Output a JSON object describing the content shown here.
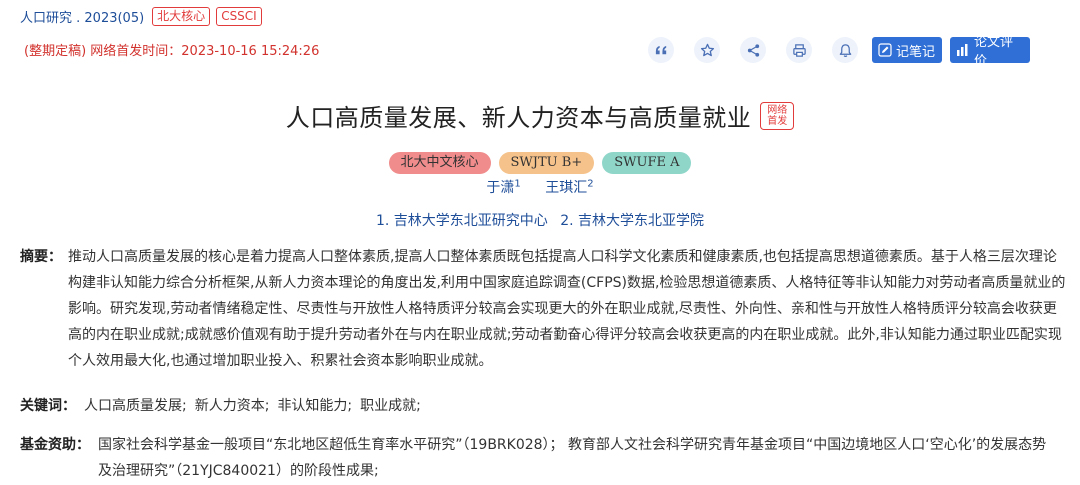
{
  "header": {
    "journal": "人口研究 . 2023(05)",
    "tags": [
      "北大核心",
      "CSSCI"
    ],
    "pub_status": "(整期定稿) 网络首发时间：2023-10-16 15:24:26"
  },
  "toolbar": {
    "icons": [
      "quote-icon",
      "star-icon",
      "share-icon",
      "print-icon",
      "bell-icon"
    ],
    "note_label": "记笔记",
    "eval_label": "论文评价",
    "accent": "#2f6fd6"
  },
  "article": {
    "title": "人口高质量发展、新人力资本与高质量就业",
    "net_badge_line1": "网络",
    "net_badge_line2": "首发",
    "rank_badges": [
      {
        "label": "北大中文核心",
        "color": "#f08c8c"
      },
      {
        "label": "SWJTU B+",
        "color": "#f6c28b"
      },
      {
        "label": "SWUFE A",
        "color": "#8fd6c9"
      }
    ],
    "authors": [
      {
        "name": "于潇",
        "sup": "1"
      },
      {
        "name": "王琪汇",
        "sup": "2"
      }
    ],
    "affiliations": [
      "1. 吉林大学东北亚研究中心",
      "2. 吉林大学东北亚学院"
    ],
    "abstract_label": "摘要：",
    "abstract": "推动人口高质量发展的核心是着力提高人口整体素质,提高人口整体素质既包括提高人口科学文化素质和健康素质,也包括提高思想道德素质。基于人格三层次理论构建非认知能力综合分析框架,从新人力资本理论的角度出发,利用中国家庭追踪调查(CFPS)数据,检验思想道德素质、人格特征等非认知能力对劳动者高质量就业的影响。研究发现,劳动者情绪稳定性、尽责性与开放性人格特质评分较高会实现更大的外在职业成就,尽责性、外向性、亲和性与开放性人格特质评分较高会收获更高的内在职业成就;成就感价值观有助于提升劳动者外在与内在职业成就;劳动者勤奋心得评分较高会收获更高的内在职业成就。此外,非认知能力通过职业匹配实现个人效用最大化,也通过增加职业投入、积累社会资本影响职业成就。",
    "keywords_label": "关键词：",
    "keywords": [
      "人口高质量发展;",
      "新人力资本;",
      "非认知能力;",
      "职业成就;"
    ],
    "fund_label": "基金资助：",
    "fund": "国家社会科学基金一般项目“东北地区超低生育率水平研究”（19BRK028）； 教育部人文社会科学研究青年基金项目“中国边境地区人口‘空心化’的发展态势及治理研究”（21YJC840021）的阶段性成果;"
  }
}
